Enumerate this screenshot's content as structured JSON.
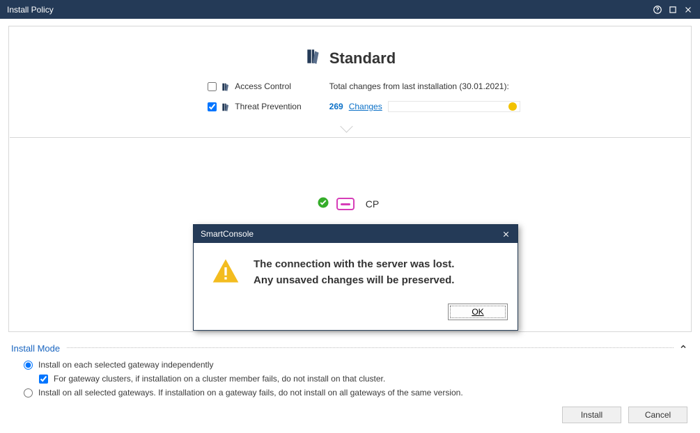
{
  "window": {
    "title": "Install Policy"
  },
  "policy": {
    "name": "Standard",
    "options": {
      "access_control": {
        "label": "Access Control",
        "checked": false
      },
      "threat_prevention": {
        "label": "Threat Prevention",
        "checked": true
      }
    },
    "changes": {
      "caption": "Total changes from last installation (30.01.2021):",
      "count": "269",
      "link_label": "Changes"
    }
  },
  "gateway": {
    "label": "CP"
  },
  "install_mode": {
    "title": "Install Mode",
    "option1": {
      "label": "Install on each selected gateway independently",
      "sub_label": "For gateway clusters, if installation on a cluster member fails, do not install on that cluster.",
      "selected": true,
      "sub_checked": true
    },
    "option2": {
      "label": "Install on all selected gateways. If installation on a gateway fails, do not install on all gateways of the same version.",
      "selected": false
    }
  },
  "footer": {
    "install": "Install",
    "cancel": "Cancel"
  },
  "modal": {
    "title": "SmartConsole",
    "line1": "The connection with the server was lost.",
    "line2": "Any unsaved changes will be preserved.",
    "ok": "OK"
  }
}
